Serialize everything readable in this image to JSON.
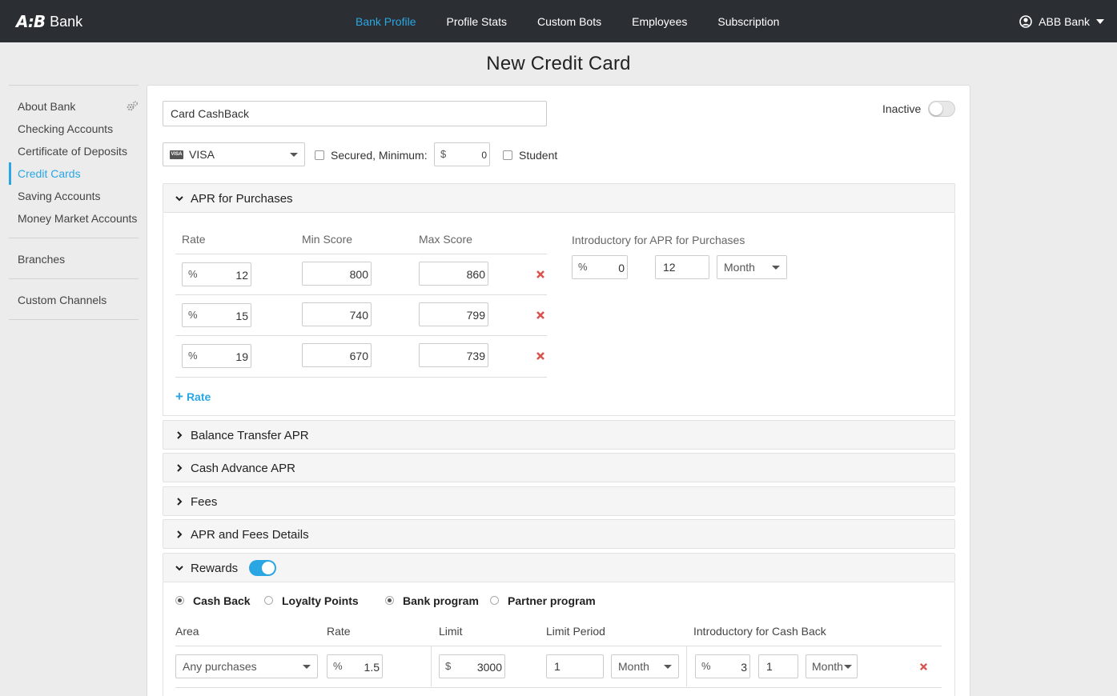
{
  "brand": {
    "mark": "A:B",
    "name": "Bank"
  },
  "nav": [
    {
      "label": "Bank Profile",
      "active": true
    },
    {
      "label": "Profile Stats"
    },
    {
      "label": "Custom Bots"
    },
    {
      "label": "Employees"
    },
    {
      "label": "Subscription"
    }
  ],
  "user": {
    "name": "ABB Bank"
  },
  "page": {
    "title": "New Credit Card"
  },
  "sidebar": {
    "groups": [
      {
        "items": [
          "About Bank",
          "Checking Accounts",
          "Certificate of Deposits",
          "Credit Cards",
          "Saving Accounts",
          "Money Market Accounts"
        ]
      },
      {
        "items": [
          "Branches"
        ]
      },
      {
        "items": [
          "Custom Channels"
        ]
      }
    ],
    "active": "Credit Cards"
  },
  "form": {
    "card_name": "Card CashBack",
    "status_label": "Inactive",
    "network": "VISA",
    "network_badge": "VISA",
    "secured_label": "Secured, Minimum:",
    "secured_currency": "$",
    "secured_min": "0",
    "student_label": "Student"
  },
  "apr_purchases": {
    "title": "APR for Purchases",
    "headers": {
      "rate": "Rate",
      "min": "Min Score",
      "max": "Max Score"
    },
    "rows": [
      {
        "unit": "%",
        "rate": "12",
        "min": "800",
        "max": "860"
      },
      {
        "unit": "%",
        "rate": "15",
        "min": "740",
        "max": "799"
      },
      {
        "unit": "%",
        "rate": "19",
        "min": "670",
        "max": "739"
      }
    ],
    "add_label": "Rate",
    "intro": {
      "label": "Introductory for APR for Purchases",
      "unit": "%",
      "rate": "0",
      "period_count": "12",
      "period": "Month"
    }
  },
  "sections": [
    "Balance Transfer APR",
    "Cash Advance APR",
    "Fees",
    "APR and Fees Details"
  ],
  "rewards": {
    "title": "Rewards",
    "enabled": true,
    "types": [
      {
        "label": "Cash Back",
        "selected": true
      },
      {
        "label": "Loyalty Points",
        "selected": false
      }
    ],
    "programs": [
      {
        "label": "Bank program",
        "selected": true
      },
      {
        "label": "Partner program",
        "selected": false
      }
    ],
    "headers": {
      "area": "Area",
      "rate": "Rate",
      "limit": "Limit",
      "period": "Limit Period",
      "intro": "Introductory for Cash Back"
    },
    "row": {
      "area": "Any purchases",
      "rate_unit": "%",
      "rate": "1.5",
      "limit_unit": "$",
      "limit": "3000",
      "period_count": "1",
      "period": "Month",
      "intro_unit": "%",
      "intro_rate": "3",
      "intro_count": "1",
      "intro_period": "Month"
    }
  },
  "colors": {
    "accent": "#2aa6e3",
    "topbar": "#2b2f33",
    "delete": "#d9534f"
  }
}
